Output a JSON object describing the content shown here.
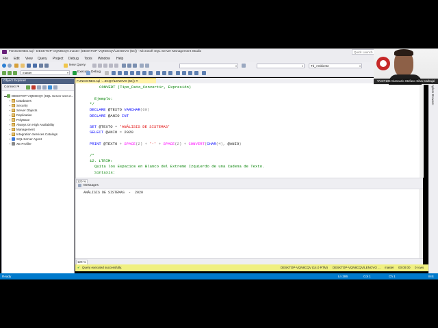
{
  "window": {
    "title": "FUNCIONES.sql - DESKTOP-VQN8CQV.master (DESKTOP-VQN8CQV\\LENOVO (54)) - Microsoft SQL Server Management Studio",
    "quick_launch_placeholder": "Quick Launch (Ctrl+Q)"
  },
  "menu": [
    "File",
    "Edit",
    "View",
    "Query",
    "Project",
    "Debug",
    "Tools",
    "Window",
    "Help"
  ],
  "toolbar": {
    "new_query": "New Query",
    "database": "master",
    "execute": "Execute",
    "debug": "Debug",
    "target_combo": "Tb_Ambiente"
  },
  "object_explorer": {
    "title": "Object Explorer",
    "connect": "Connect ▾",
    "server": "DESKTOP-VQN8CQV (SQL Server 14.0.2...",
    "nodes": [
      "Databases",
      "Security",
      "Server Objects",
      "Replication",
      "PolyBase",
      "Always On High Availability",
      "Management",
      "Integration Services Catalogs",
      "SQL Server Agent",
      "XE Profiler"
    ]
  },
  "editor": {
    "tab_label": "FUNCIONES.sql -...8CQV\\LENOVO (54))",
    "zoom": "120 %"
  },
  "code": [
    {
      "indent": 2,
      "parts": [
        {
          "t": "CONVERT (Tipo_Dato_Convertir, Expresión)",
          "c": "cmt"
        }
      ]
    },
    {
      "indent": 0,
      "parts": [
        {
          "t": "",
          "c": ""
        }
      ]
    },
    {
      "indent": 1,
      "parts": [
        {
          "t": "Ejemplo:",
          "c": "cmt"
        }
      ]
    },
    {
      "indent": 0,
      "parts": [
        {
          "t": "*/",
          "c": "cmt"
        }
      ]
    },
    {
      "indent": 0,
      "parts": [
        {
          "t": "DECLARE ",
          "c": "kw"
        },
        {
          "t": "@TEXTO ",
          "c": ""
        },
        {
          "t": "VARCHAR",
          "c": "kw"
        },
        {
          "t": "(60)",
          "c": "gray"
        }
      ]
    },
    {
      "indent": 0,
      "parts": [
        {
          "t": "DECLARE ",
          "c": "kw"
        },
        {
          "t": "@ANIO ",
          "c": ""
        },
        {
          "t": "INT",
          "c": "kw"
        }
      ]
    },
    {
      "indent": 0,
      "parts": [
        {
          "t": "",
          "c": ""
        }
      ]
    },
    {
      "indent": 0,
      "parts": [
        {
          "t": "SET ",
          "c": "kw"
        },
        {
          "t": "@TEXTO ",
          "c": ""
        },
        {
          "t": "= ",
          "c": "gray"
        },
        {
          "t": "'ANÁLISIS DE SISTEMAS'",
          "c": "str"
        }
      ]
    },
    {
      "indent": 0,
      "parts": [
        {
          "t": "SELECT ",
          "c": "kw"
        },
        {
          "t": "@ANIO ",
          "c": ""
        },
        {
          "t": "= ",
          "c": "gray"
        },
        {
          "t": "2020",
          "c": ""
        }
      ]
    },
    {
      "indent": 0,
      "parts": [
        {
          "t": "",
          "c": ""
        }
      ]
    },
    {
      "indent": 0,
      "parts": [
        {
          "t": "PRINT ",
          "c": "kw"
        },
        {
          "t": "@TEXTO ",
          "c": ""
        },
        {
          "t": "+ ",
          "c": "gray"
        },
        {
          "t": "SPACE",
          "c": "fn"
        },
        {
          "t": "(2) + ",
          "c": "gray"
        },
        {
          "t": "'-'",
          "c": "str"
        },
        {
          "t": " + ",
          "c": "gray"
        },
        {
          "t": "SPACE",
          "c": "fn"
        },
        {
          "t": "(2) + ",
          "c": "gray"
        },
        {
          "t": "CONVERT",
          "c": "fn"
        },
        {
          "t": "(",
          "c": "gray"
        },
        {
          "t": "CHAR",
          "c": "kw"
        },
        {
          "t": "(4), ",
          "c": "gray"
        },
        {
          "t": "@ANIO",
          "c": ""
        },
        {
          "t": ")",
          "c": "gray"
        }
      ]
    },
    {
      "indent": 0,
      "parts": [
        {
          "t": "",
          "c": ""
        }
      ]
    },
    {
      "indent": 0,
      "parts": [
        {
          "t": "/*",
          "c": "cmt"
        }
      ]
    },
    {
      "indent": 0,
      "parts": [
        {
          "t": "12. LTRIM:",
          "c": "cmt"
        }
      ]
    },
    {
      "indent": 1,
      "parts": [
        {
          "t": "Quita los Espacios en Blanco del Extremo Izquierdo de una Cadena de Texto.",
          "c": "cmt"
        }
      ]
    },
    {
      "indent": 1,
      "parts": [
        {
          "t": "Sintaxis:",
          "c": "cmt"
        }
      ]
    }
  ],
  "messages": {
    "tab": "Messages",
    "output": "ANÁLISIS DE SISTEMAS  -  2020",
    "zoom": "120 %"
  },
  "query_status": {
    "message": "Query executed successfully.",
    "server": "DESKTOP-VQN8CQV (14.0 RTM)",
    "user": "DESKTOP-VQN8CQV\\LENOVO ...",
    "db": "master",
    "time": "00:00:00",
    "rows": "0 rows"
  },
  "statusbar": {
    "left": "Ready",
    "ln": "Ln 386",
    "col": "Col 1",
    "ch": "Ch 1",
    "mode": "INS"
  },
  "right_panel": "Template Browser",
  "webcam": {
    "name": "TAGIT105 Giancarlo Stefano Silva Carbajal"
  },
  "colors": {
    "accent": "#007acc",
    "keyword": "#0000ff",
    "string": "#e00000",
    "comment": "#008000",
    "function": "#ff00ff",
    "status_ok": "#f0f081"
  }
}
